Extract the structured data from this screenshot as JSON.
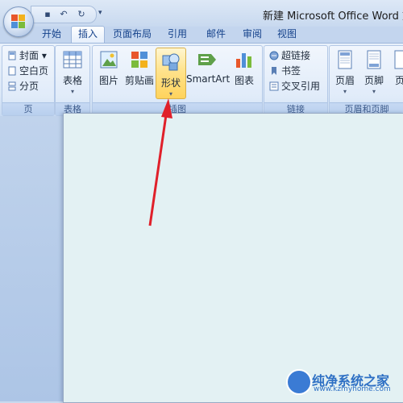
{
  "window": {
    "title": "新建 Microsoft Office Word 文档"
  },
  "qat": {
    "save_icon": "save-icon",
    "undo_icon": "undo-icon",
    "redo_icon": "redo-icon",
    "customize": "▾"
  },
  "tabs": [
    {
      "label": "开始"
    },
    {
      "label": "插入",
      "active": true
    },
    {
      "label": "页面布局"
    },
    {
      "label": "引用"
    },
    {
      "label": "邮件"
    },
    {
      "label": "审阅"
    },
    {
      "label": "视图"
    }
  ],
  "ribbon": {
    "pages": {
      "label": "页",
      "items": [
        "封面",
        "空白页",
        "分页"
      ]
    },
    "tables": {
      "label": "表格",
      "button": "表格"
    },
    "illustrations": {
      "label": "插图",
      "buttons": [
        "图片",
        "剪贴画",
        "形状",
        "SmartArt",
        "图表"
      ]
    },
    "links": {
      "label": "链接",
      "items": [
        "超链接",
        "书签",
        "交叉引用"
      ]
    },
    "header_footer": {
      "label": "页眉和页脚",
      "buttons": [
        "页眉",
        "页脚",
        "页"
      ]
    }
  },
  "watermark": {
    "name": "纯净系统之家",
    "url": "www.kzmyhome.com"
  },
  "colors": {
    "accent": "#15428b",
    "highlight": "#ffd35c",
    "arrow": "#e0202a"
  }
}
